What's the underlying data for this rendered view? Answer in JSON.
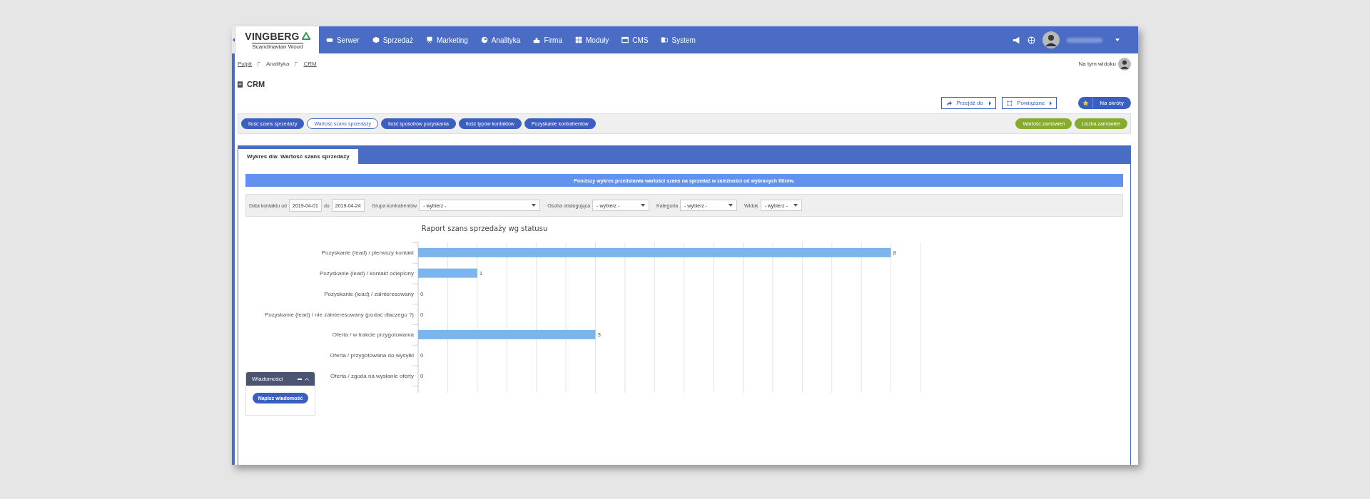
{
  "nav": {
    "logo": {
      "name": "VINGBERG",
      "tagline": "Scandinavian Wood"
    },
    "items": [
      {
        "label": "Serwer"
      },
      {
        "label": "Sprzedaż"
      },
      {
        "label": "Marketing"
      },
      {
        "label": "Analityka"
      },
      {
        "label": "Firma"
      },
      {
        "label": "Moduły"
      },
      {
        "label": "CMS"
      },
      {
        "label": "System"
      }
    ]
  },
  "breadcrumb": [
    {
      "label": "Pulpit",
      "link": true
    },
    {
      "label": "Analityka",
      "link": false
    },
    {
      "label": "CRM",
      "link": true
    }
  ],
  "view_label": "Na tym widoku",
  "page_title": "CRM",
  "actions": [
    {
      "label": "Przejdź do",
      "kind": "outline"
    },
    {
      "label": "Powiązane",
      "kind": "outline"
    },
    {
      "label": "Na skróty",
      "kind": "star"
    }
  ],
  "report_tabs": [
    {
      "label": "Ilość szans sprzedaży",
      "selected": false
    },
    {
      "label": "Wartość szans sprzedaży",
      "selected": true
    },
    {
      "label": "Ilość sposobów pozyskania",
      "selected": false
    },
    {
      "label": "Ilość typów kontaktów",
      "selected": false
    },
    {
      "label": "Pozyskanie kontrahentów",
      "selected": false
    }
  ],
  "order_buttons": [
    "Wartość zamówień",
    "Liczba zamówień"
  ],
  "panel_tab": "Wykres dla: Wartość szans sprzedaży",
  "info": "Poniższy wykres przedstawia wartości szans na sprzedaż w zależności od wybranych filtrów.",
  "filters": [
    {
      "kind": "date",
      "label": "Data kontaktu od",
      "value": "2019-04-01"
    },
    {
      "kind": "date",
      "label": "do",
      "value": "2019-04-24"
    },
    {
      "kind": "select",
      "label": "Grupa kontrahentów",
      "value": "- wybierz -"
    },
    {
      "kind": "select",
      "label": "Osoba obsługująca",
      "value": "- wybierz -"
    },
    {
      "kind": "select",
      "label": "Kategoria",
      "value": "- wybierz -"
    },
    {
      "kind": "select",
      "label": "Widok",
      "value": "- wybierz -"
    }
  ],
  "chart_data": {
    "type": "bar",
    "orientation": "horizontal",
    "title": "Raport szans sprzedaży wg statusu",
    "data_labels": true,
    "xlim": [
      0,
      8.5
    ],
    "categories": [
      "Pozyskanie (lead) / pierwszy kontakt",
      "Pozyskanie (lead) / kontakt ocieplony",
      "Pozyskanie (lead) / zainteresowany",
      "Pozyskanie (lead) / nie zainteresowany (podać dlaczego ?)",
      "Oferta / w trakcie przygotowania",
      "Oferta / przygotowana do wysyłki",
      "Oferta / zgoda na wysłanie oferty"
    ],
    "series": [
      {
        "color": "#7cb5ec",
        "values": [
          8,
          1,
          0,
          0,
          3,
          0,
          0
        ]
      }
    ]
  },
  "messages": {
    "title": "Wiadomości",
    "button": "Napisz wiadomość"
  }
}
